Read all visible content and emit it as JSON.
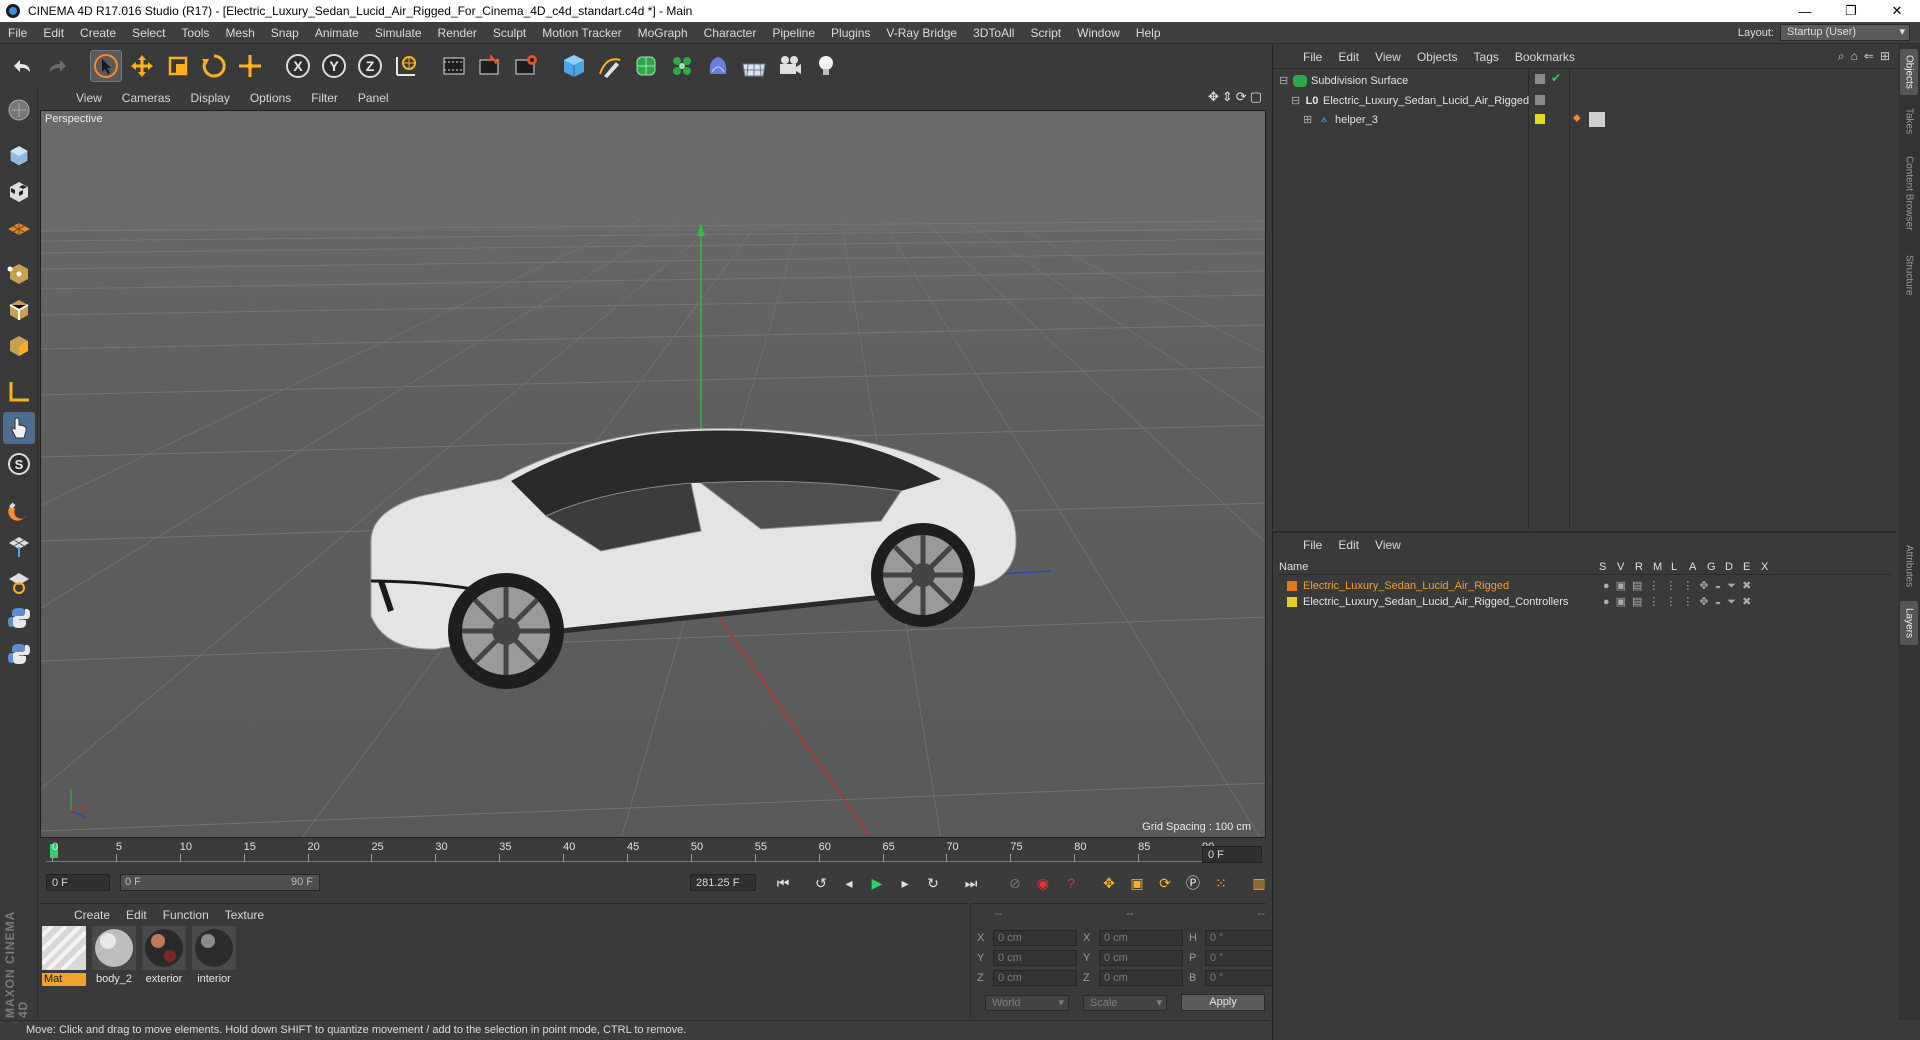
{
  "window": {
    "title": "CINEMA 4D R17.016 Studio (R17) - [Electric_Luxury_Sedan_Lucid_Air_Rigged_For_Cinema_4D_c4d_standart.c4d *] - Main",
    "controls": {
      "minimize": "—",
      "restore": "❐",
      "close": "✕"
    }
  },
  "menubar": {
    "items": [
      "File",
      "Edit",
      "Create",
      "Select",
      "Tools",
      "Mesh",
      "Snap",
      "Animate",
      "Simulate",
      "Render",
      "Sculpt",
      "Motion Tracker",
      "MoGraph",
      "Character",
      "Pipeline",
      "Plugins",
      "V-Ray Bridge",
      "3DToAll",
      "Script",
      "Window",
      "Help"
    ],
    "layout_label": "Layout:",
    "layout_value": "Startup (User)"
  },
  "toolbar": {
    "icons": [
      "undo-icon",
      "redo-icon",
      "select-arrow-icon",
      "move-icon",
      "scale-icon",
      "rotate-icon",
      "live-selection-icon",
      "x-axis-icon",
      "y-axis-icon",
      "z-axis-icon",
      "world-coordinates-icon",
      "render-view-icon",
      "render-picture-viewer-icon",
      "edit-render-settings-icon",
      "cube-icon",
      "pen-spline-icon",
      "subdivision-icon",
      "mograph-cloner-icon",
      "deformer-icon",
      "floor-icon",
      "camera-icon",
      "light-icon"
    ],
    "axis_x": "X",
    "axis_y": "Y",
    "axis_z": "Z"
  },
  "lefttools": {
    "icons": [
      "make-editable-icon",
      "model-mode-icon",
      "texture-mode-icon",
      "workplane-icon",
      "points-mode-icon",
      "edges-mode-icon",
      "polygons-mode-icon",
      "axis-mode-icon",
      "tweak-mode-icon",
      "solo-mode-icon",
      "snap-magnet-icon",
      "grid-snap-icon",
      "enable-axis-icon",
      "python-icon",
      "python-script-icon"
    ],
    "solo_letter": "S"
  },
  "maxon_logo": "MAXON CINEMA 4D",
  "viewport": {
    "menu": [
      "View",
      "Cameras",
      "Display",
      "Options",
      "Filter",
      "Panel"
    ],
    "nav_icons": [
      "move-view-icon",
      "zoom-view-icon",
      "rotate-view-icon",
      "maximize-view-icon"
    ],
    "label": "Perspective",
    "grid_spacing": "Grid Spacing : 100 cm"
  },
  "timeline": {
    "ticks": [
      "0",
      "5",
      "10",
      "15",
      "20",
      "25",
      "30",
      "35",
      "40",
      "45",
      "50",
      "55",
      "60",
      "65",
      "70",
      "75",
      "80",
      "85",
      "90"
    ],
    "current_frame": "0 F",
    "start_field": "0 F",
    "range_start": "0 F",
    "range_end": "90 F",
    "fps_field": "281.25 F"
  },
  "materials": {
    "menu": [
      "Create",
      "Edit",
      "Function",
      "Texture"
    ],
    "items": [
      {
        "label": "Mat",
        "selected": true
      },
      {
        "label": "body_2",
        "selected": false
      },
      {
        "label": "exterior",
        "selected": false
      },
      {
        "label": "interior",
        "selected": false
      }
    ]
  },
  "coordinates": {
    "headers": [
      "--",
      "--",
      "--"
    ],
    "rows": [
      {
        "a": "X",
        "av": "0 cm",
        "b": "X",
        "bv": "0 cm",
        "c": "H",
        "cv": "0 °"
      },
      {
        "a": "Y",
        "av": "0 cm",
        "b": "Y",
        "bv": "0 cm",
        "c": "P",
        "cv": "0 °"
      },
      {
        "a": "Z",
        "av": "0 cm",
        "b": "Z",
        "bv": "0 cm",
        "c": "B",
        "cv": "0 °"
      }
    ],
    "space": "World",
    "mode": "Scale",
    "apply": "Apply"
  },
  "status": "Move: Click and drag to move elements. Hold down SHIFT to quantize movement / add to the selection in point mode, CTRL to remove.",
  "objects": {
    "menu": [
      "File",
      "Edit",
      "View",
      "Objects",
      "Tags",
      "Bookmarks"
    ],
    "rows": [
      {
        "name": "Subdivision Surface",
        "icon": "subdivision-surface-icon"
      },
      {
        "name": "Electric_Luxury_Sedan_Lucid_Air_Rigged",
        "icon": "null-object-icon"
      },
      {
        "name": "helper_3",
        "icon": "joint-icon"
      }
    ]
  },
  "layers": {
    "menu": [
      "File",
      "Edit",
      "View"
    ],
    "header": {
      "name": "Name",
      "flags": [
        "S",
        "V",
        "R",
        "M",
        "L",
        "A",
        "G",
        "D",
        "E",
        "X"
      ]
    },
    "rows": [
      {
        "name": "Electric_Luxury_Sedan_Lucid_Air_Rigged",
        "color": "#e07a1e",
        "text_color": "#f0a030"
      },
      {
        "name": "Electric_Luxury_Sedan_Lucid_Air_Rigged_Controllers",
        "color": "#e8d020",
        "text_color": "#e4e4e4"
      }
    ]
  },
  "right_tabs": [
    "Objects",
    "Takes",
    "Content Browser",
    "Structure",
    "Attributes",
    "Layers"
  ],
  "colors": {
    "accent": "#f0a22c",
    "selection": "#4e6c8c",
    "panel": "#3a3a3a"
  }
}
